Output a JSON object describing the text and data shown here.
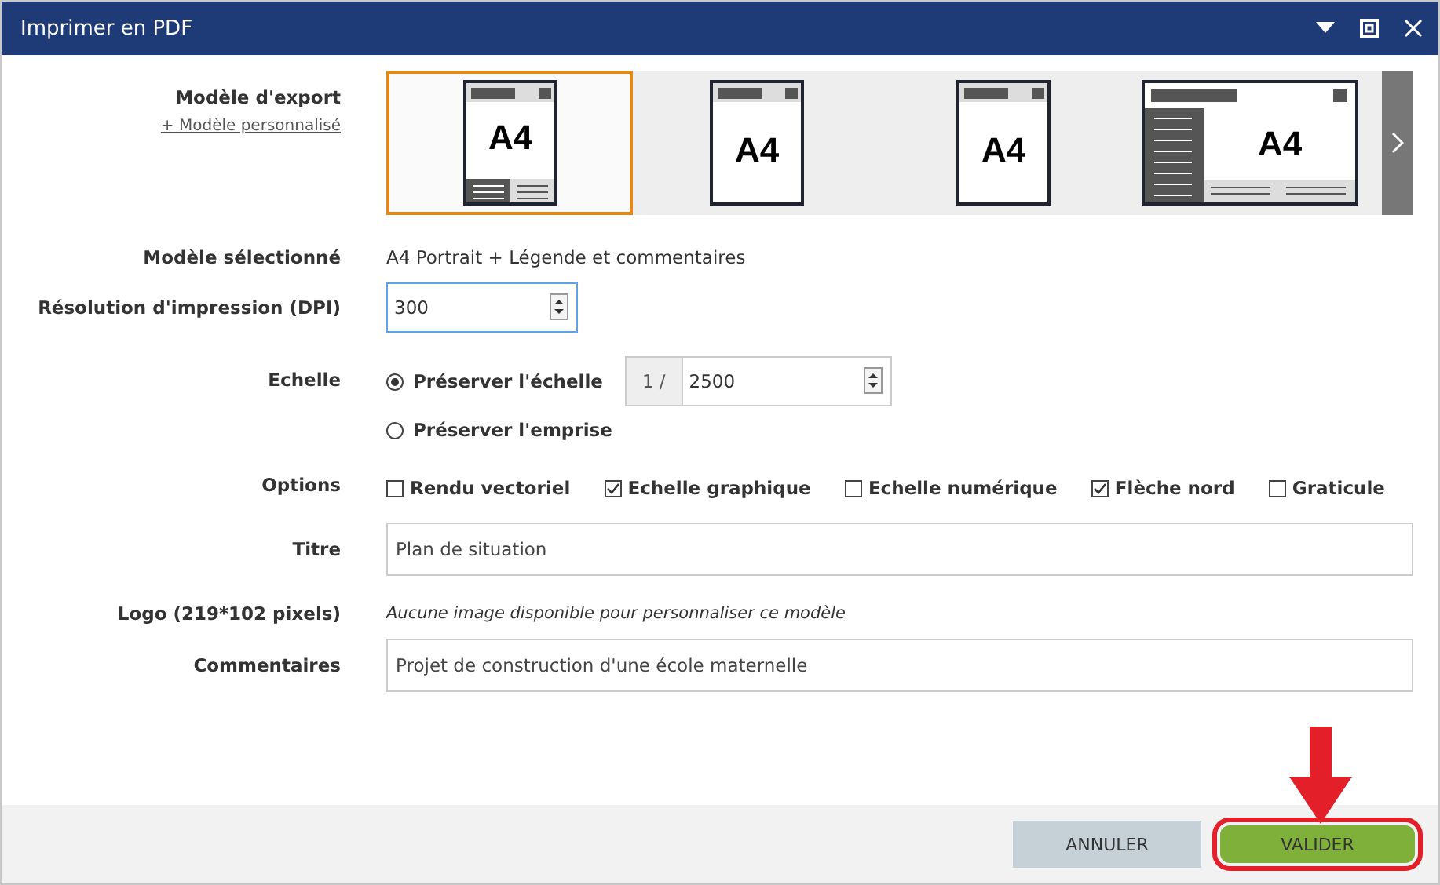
{
  "window": {
    "title": "Imprimer en PDF"
  },
  "export_model": {
    "label": "Modèle d'export",
    "custom_link": "+ Modèle personnalisé",
    "templates": [
      {
        "kind": "portrait-legend",
        "text": "A4",
        "selected": true
      },
      {
        "kind": "portrait",
        "text": "A4",
        "selected": false
      },
      {
        "kind": "portrait",
        "text": "A4",
        "selected": false
      },
      {
        "kind": "landscape",
        "text": "A4",
        "selected": false
      }
    ]
  },
  "selected_model": {
    "label": "Modèle sélectionné",
    "value": "A4 Portrait + Légende et commentaires"
  },
  "resolution": {
    "label": "Résolution d'impression (DPI)",
    "value": "300"
  },
  "scale": {
    "label": "Echelle",
    "prefix": "1 /",
    "value": "2500",
    "options": [
      {
        "label": "Préserver l'échelle",
        "selected": true
      },
      {
        "label": "Préserver l'emprise",
        "selected": false
      }
    ]
  },
  "options": {
    "label": "Options",
    "items": [
      {
        "label": "Rendu vectoriel",
        "checked": false
      },
      {
        "label": "Echelle graphique",
        "checked": true
      },
      {
        "label": "Echelle numérique",
        "checked": false
      },
      {
        "label": "Flèche nord",
        "checked": true
      },
      {
        "label": "Graticule",
        "checked": false
      }
    ]
  },
  "title_field": {
    "label": "Titre",
    "value": "Plan de situation"
  },
  "logo": {
    "label": "Logo (219*102 pixels)",
    "note": "Aucune image disponible pour personnaliser ce modèle"
  },
  "comments": {
    "label": "Commentaires",
    "value": "Projet de construction d'une école maternelle"
  },
  "buttons": [
    {
      "kind": "cancel",
      "label": "ANNULER",
      "highlighted": false
    },
    {
      "kind": "confirm",
      "label": "VALIDER",
      "highlighted": true
    }
  ]
}
